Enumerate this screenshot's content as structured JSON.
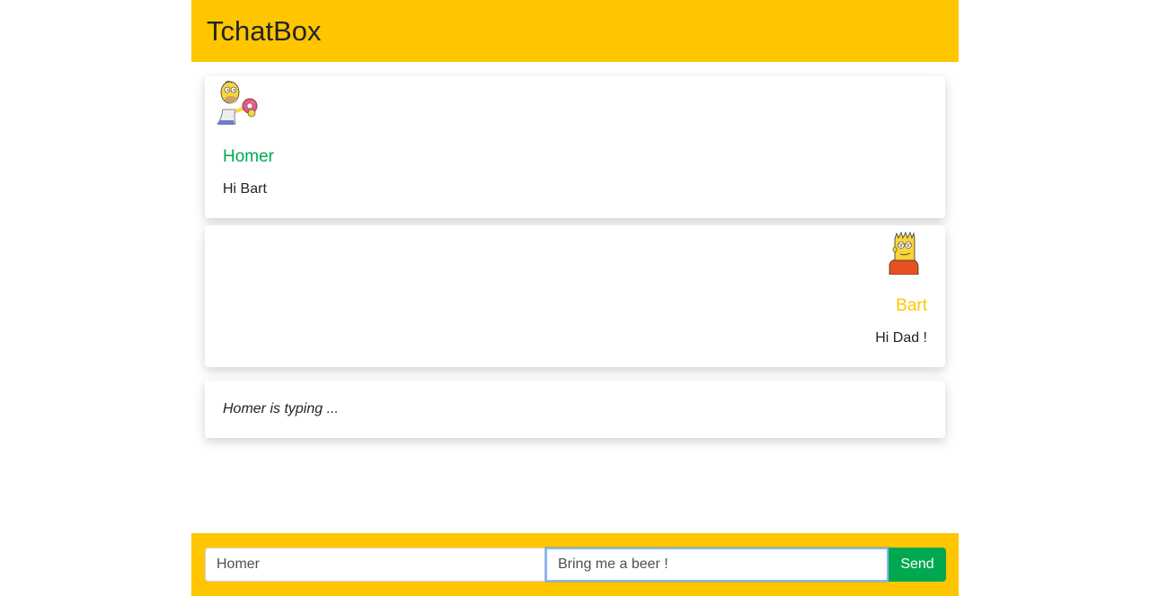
{
  "app": {
    "title": "TchatBox"
  },
  "messages": [
    {
      "author": "Homer",
      "text": "Hi Bart",
      "align": "left",
      "avatar": "homer-avatar",
      "color": "#00a94f"
    },
    {
      "author": "Bart",
      "text": "Hi Dad !",
      "align": "right",
      "avatar": "bart-avatar",
      "color": "#ffc600"
    }
  ],
  "typing": {
    "text": "Homer is typing ..."
  },
  "composer": {
    "author_value": "Homer",
    "message_value": "Bring me a beer !",
    "send_label": "Send"
  },
  "colors": {
    "brand": "#ffc600",
    "accent": "#00a94f"
  }
}
